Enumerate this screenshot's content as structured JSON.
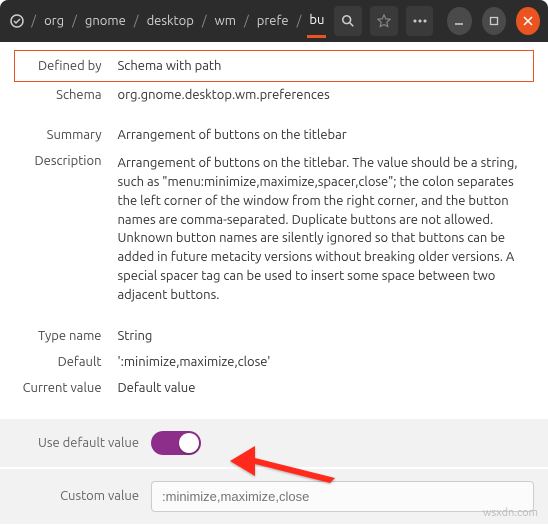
{
  "titlebar": {
    "breadcrumbs": [
      "org",
      "gnome",
      "desktop",
      "wm",
      "prefe",
      "bu"
    ]
  },
  "props": {
    "defined_by_label": "Defined by",
    "defined_by_value": "Schema with path",
    "schema_label": "Schema",
    "schema_value": "org.gnome.desktop.wm.preferences",
    "summary_label": "Summary",
    "summary_value": "Arrangement of buttons on the titlebar",
    "description_label": "Description",
    "description_value": "Arrangement of buttons on the titlebar. The value should be a string, such as \"menu:minimize,maximize,spacer,close\"; the colon separates the left corner of the window from the right corner, and the button names are comma-separated. Duplicate buttons are not allowed. Unknown button names are silently ignored so that buttons can be added in future metacity versions without breaking older versions. A special spacer tag can be used to insert some space between two adjacent buttons.",
    "type_label": "Type name",
    "type_value": "String",
    "default_label": "Default",
    "default_value": "':minimize,maximize,close'",
    "current_label": "Current value",
    "current_value": "Default value"
  },
  "controls": {
    "use_default_label": "Use default value",
    "custom_label": "Custom value",
    "custom_placeholder": ":minimize,maximize,close"
  },
  "watermark": "wsxdn.com"
}
